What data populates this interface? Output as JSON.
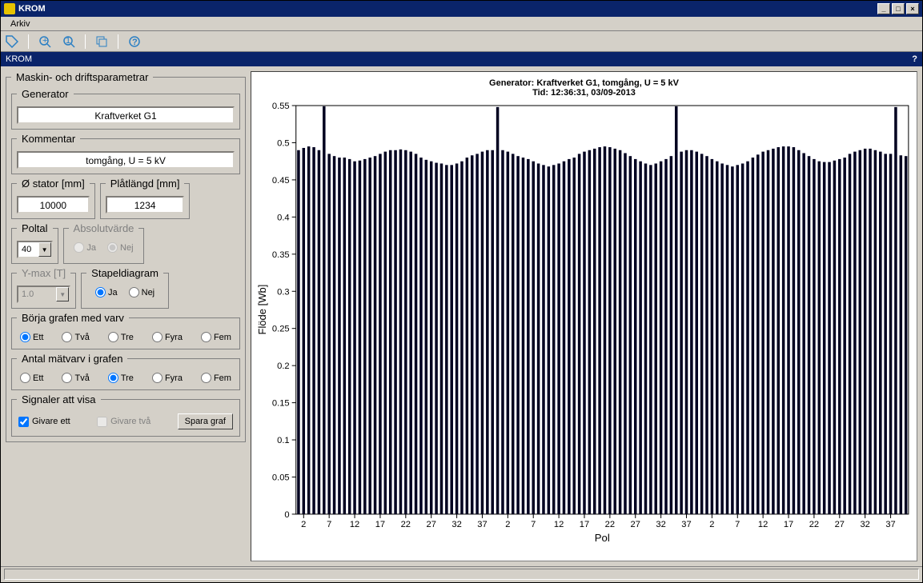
{
  "window": {
    "title": "KROM"
  },
  "menu": {
    "arkiv": "Arkiv"
  },
  "subbar": {
    "title": "KROM",
    "help": "?"
  },
  "panel": {
    "main_legend": "Maskin- och driftsparametrar",
    "generator": {
      "legend": "Generator",
      "value": "Kraftverket G1"
    },
    "kommentar": {
      "legend": "Kommentar",
      "value": "tomgång, U = 5 kV"
    },
    "stator": {
      "legend": "Ø stator [mm]",
      "value": "10000"
    },
    "platlangd": {
      "legend": "Plåtlängd [mm]",
      "value": "1234"
    },
    "poltal": {
      "legend": "Poltal",
      "value": "40"
    },
    "absolutvarde": {
      "legend": "Absolutvärde",
      "ja": "Ja",
      "nej": "Nej"
    },
    "ymax": {
      "legend": "Y-max [T]",
      "value": "1.0"
    },
    "stapeldiagram": {
      "legend": "Stapeldiagram",
      "ja": "Ja",
      "nej": "Nej"
    },
    "borja": {
      "legend": "Börja grafen med varv"
    },
    "antal": {
      "legend": "Antal mätvarv i grafen"
    },
    "varv_opts": {
      "ett": "Ett",
      "tva": "Två",
      "tre": "Tre",
      "fyra": "Fyra",
      "fem": "Fem"
    },
    "signaler": {
      "legend": "Signaler att visa",
      "givare_ett": "Givare ett",
      "givare_tva": "Givare två",
      "spara": "Spara graf"
    }
  },
  "chart_data": {
    "type": "bar",
    "title_line1": "Generator: Kraftverket G1, tomgång, U = 5 kV",
    "title_line2": "Tid: 12:36:31, 03/09-2013",
    "xlabel": "Pol",
    "ylabel": "Flöde [Wb]",
    "ylim": [
      0,
      0.55
    ],
    "yticks": [
      0,
      0.05,
      0.1,
      0.15,
      0.2,
      0.25,
      0.3,
      0.35,
      0.4,
      0.45,
      0.5,
      0.55
    ],
    "xticks_per_block": [
      2,
      7,
      12,
      17,
      22,
      27,
      32,
      37
    ],
    "n_blocks": 3,
    "n_poles_per_block": 40,
    "values": [
      0.49,
      0.493,
      0.495,
      0.494,
      0.49,
      0.549,
      0.485,
      0.482,
      0.48,
      0.48,
      0.478,
      0.475,
      0.476,
      0.478,
      0.48,
      0.482,
      0.485,
      0.488,
      0.49,
      0.49,
      0.491,
      0.49,
      0.488,
      0.485,
      0.48,
      0.477,
      0.475,
      0.473,
      0.472,
      0.47,
      0.47,
      0.472,
      0.475,
      0.48,
      0.483,
      0.485,
      0.488,
      0.49,
      0.49,
      0.548,
      0.49,
      0.488,
      0.485,
      0.482,
      0.48,
      0.478,
      0.475,
      0.472,
      0.47,
      0.468,
      0.47,
      0.472,
      0.475,
      0.478,
      0.48,
      0.485,
      0.488,
      0.49,
      0.492,
      0.494,
      0.495,
      0.494,
      0.492,
      0.49,
      0.486,
      0.482,
      0.478,
      0.475,
      0.472,
      0.47,
      0.472,
      0.475,
      0.478,
      0.482,
      0.549,
      0.488,
      0.49,
      0.49,
      0.488,
      0.485,
      0.482,
      0.478,
      0.475,
      0.472,
      0.47,
      0.468,
      0.47,
      0.472,
      0.475,
      0.48,
      0.484,
      0.488,
      0.49,
      0.492,
      0.494,
      0.495,
      0.495,
      0.494,
      0.49,
      0.486,
      0.482,
      0.478,
      0.475,
      0.474,
      0.474,
      0.476,
      0.478,
      0.48,
      0.485,
      0.488,
      0.49,
      0.492,
      0.492,
      0.49,
      0.488,
      0.485,
      0.485,
      0.548,
      0.483,
      0.482
    ]
  }
}
